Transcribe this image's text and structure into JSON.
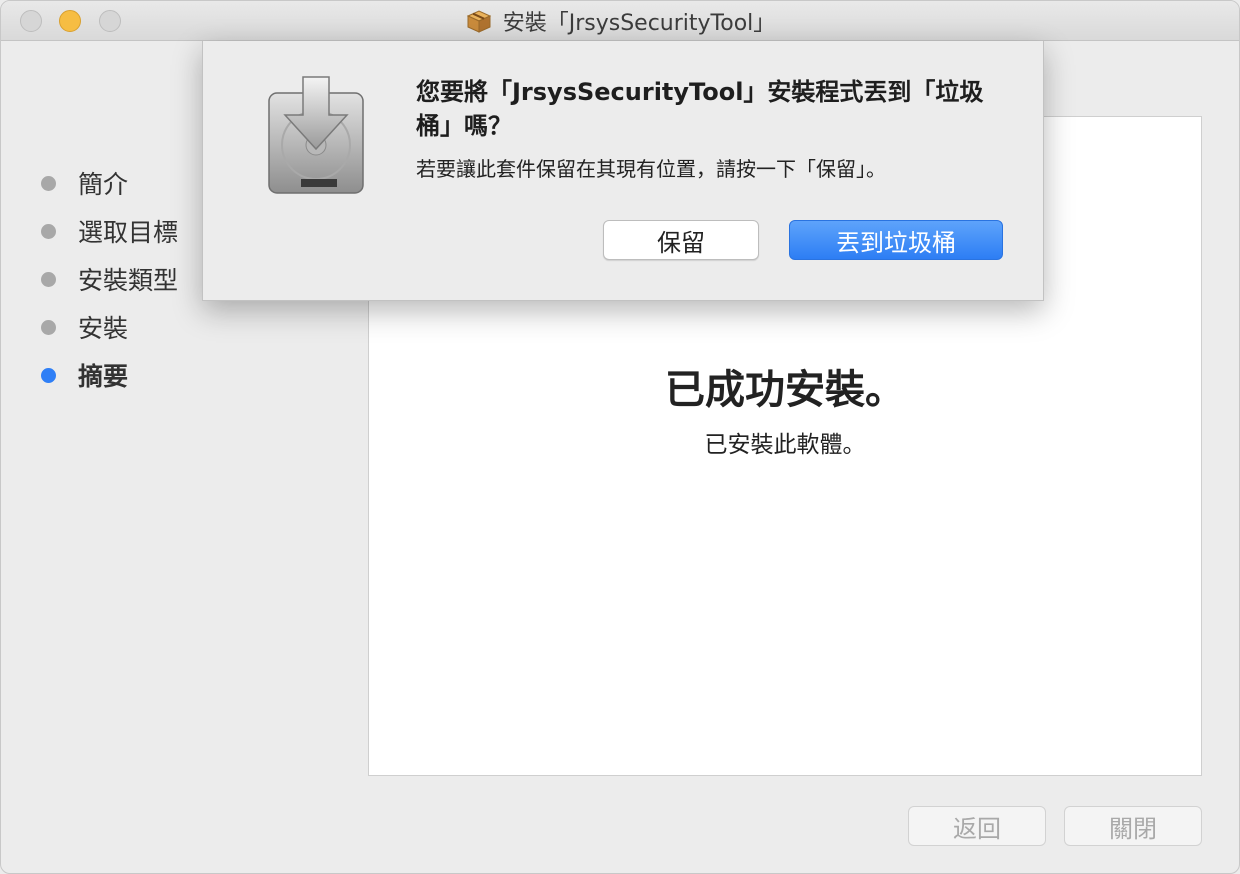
{
  "window": {
    "title": "安裝「JrsysSecurityTool」",
    "title_icon": "package-icon"
  },
  "sidebar": {
    "steps": [
      {
        "label": "簡介",
        "active": false
      },
      {
        "label": "選取目標",
        "active": false
      },
      {
        "label": "安裝類型",
        "active": false
      },
      {
        "label": "安裝",
        "active": false
      },
      {
        "label": "摘要",
        "active": true
      }
    ]
  },
  "main": {
    "success_title": "已成功安裝。",
    "success_subtitle": "已安裝此軟體。"
  },
  "footer": {
    "back_label": "返回",
    "close_label": "關閉"
  },
  "dialog": {
    "icon": "disk-download-icon",
    "title": "您要將「JrsysSecurityTool」安裝程式丟到「垃圾桶」嗎？",
    "message": "若要讓此套件保留在其現有位置，請按一下「保留」。",
    "keep_label": "保留",
    "trash_label": "丟到垃圾桶"
  },
  "colors": {
    "accent": "#2f7ff6",
    "success": "#6ac24b",
    "minimize": "#f6bd43"
  }
}
